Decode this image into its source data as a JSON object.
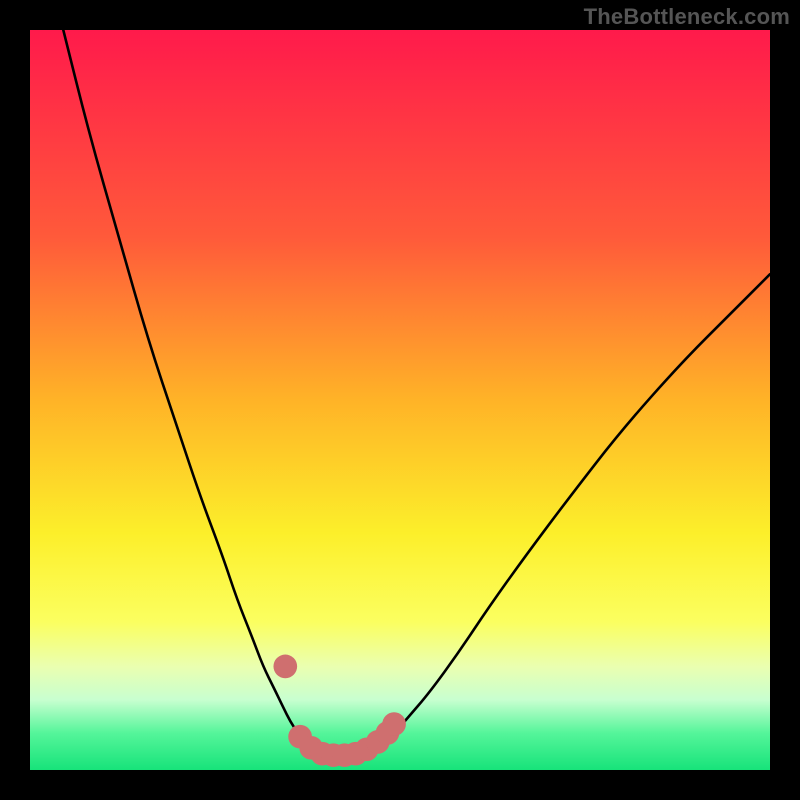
{
  "watermark": "TheBottleneck.com",
  "colors": {
    "frame": "#000000",
    "watermark": "#555555",
    "curve_stroke": "#000000",
    "marker_fill": "#cf6f6f",
    "gradient_stops": [
      {
        "offset": 0.0,
        "color": "#ff1a4b"
      },
      {
        "offset": 0.28,
        "color": "#ff5a3a"
      },
      {
        "offset": 0.5,
        "color": "#ffb327"
      },
      {
        "offset": 0.68,
        "color": "#fcef2a"
      },
      {
        "offset": 0.8,
        "color": "#fbff60"
      },
      {
        "offset": 0.86,
        "color": "#eaffb0"
      },
      {
        "offset": 0.905,
        "color": "#c8ffd0"
      },
      {
        "offset": 0.95,
        "color": "#55f59a"
      },
      {
        "offset": 1.0,
        "color": "#17e37a"
      }
    ]
  },
  "chart_data": {
    "type": "line",
    "title": "",
    "xlabel": "",
    "ylabel": "",
    "xlim": [
      0,
      100
    ],
    "ylim": [
      0,
      100
    ],
    "note": "y is rendered inverted (0 at top, 100 at bottom of plot area). Values are estimated from pixel positions; axes have no visible tick labels.",
    "series": [
      {
        "name": "left-curve",
        "x": [
          4.5,
          8,
          12,
          16,
          20,
          23,
          26,
          28,
          30,
          31.5,
          33,
          34.2,
          35.2,
          36.2,
          37.5,
          39,
          41,
          43
        ],
        "y": [
          0,
          14,
          28,
          42,
          54,
          63,
          71,
          77,
          82,
          86,
          89,
          91.5,
          93.5,
          95,
          96.3,
          97.2,
          97.8,
          98
        ]
      },
      {
        "name": "right-curve",
        "x": [
          43,
          45,
          47,
          49,
          51,
          54,
          58,
          62,
          67,
          73,
          80,
          88,
          95,
          100
        ],
        "y": [
          98,
          97.6,
          96.8,
          95.3,
          93,
          89.5,
          84,
          78,
          71,
          63,
          54,
          45,
          38,
          33
        ]
      }
    ],
    "markers": {
      "name": "bottom-cluster",
      "shape": "circle",
      "radius_pct": 1.6,
      "points": [
        {
          "x": 34.5,
          "y": 86
        },
        {
          "x": 36.5,
          "y": 95.5
        },
        {
          "x": 38,
          "y": 97
        },
        {
          "x": 39.5,
          "y": 97.8
        },
        {
          "x": 41,
          "y": 98
        },
        {
          "x": 42.5,
          "y": 98
        },
        {
          "x": 44,
          "y": 97.8
        },
        {
          "x": 45.5,
          "y": 97.2
        },
        {
          "x": 47,
          "y": 96.2
        },
        {
          "x": 48.3,
          "y": 95
        },
        {
          "x": 49.2,
          "y": 93.8
        }
      ]
    }
  }
}
